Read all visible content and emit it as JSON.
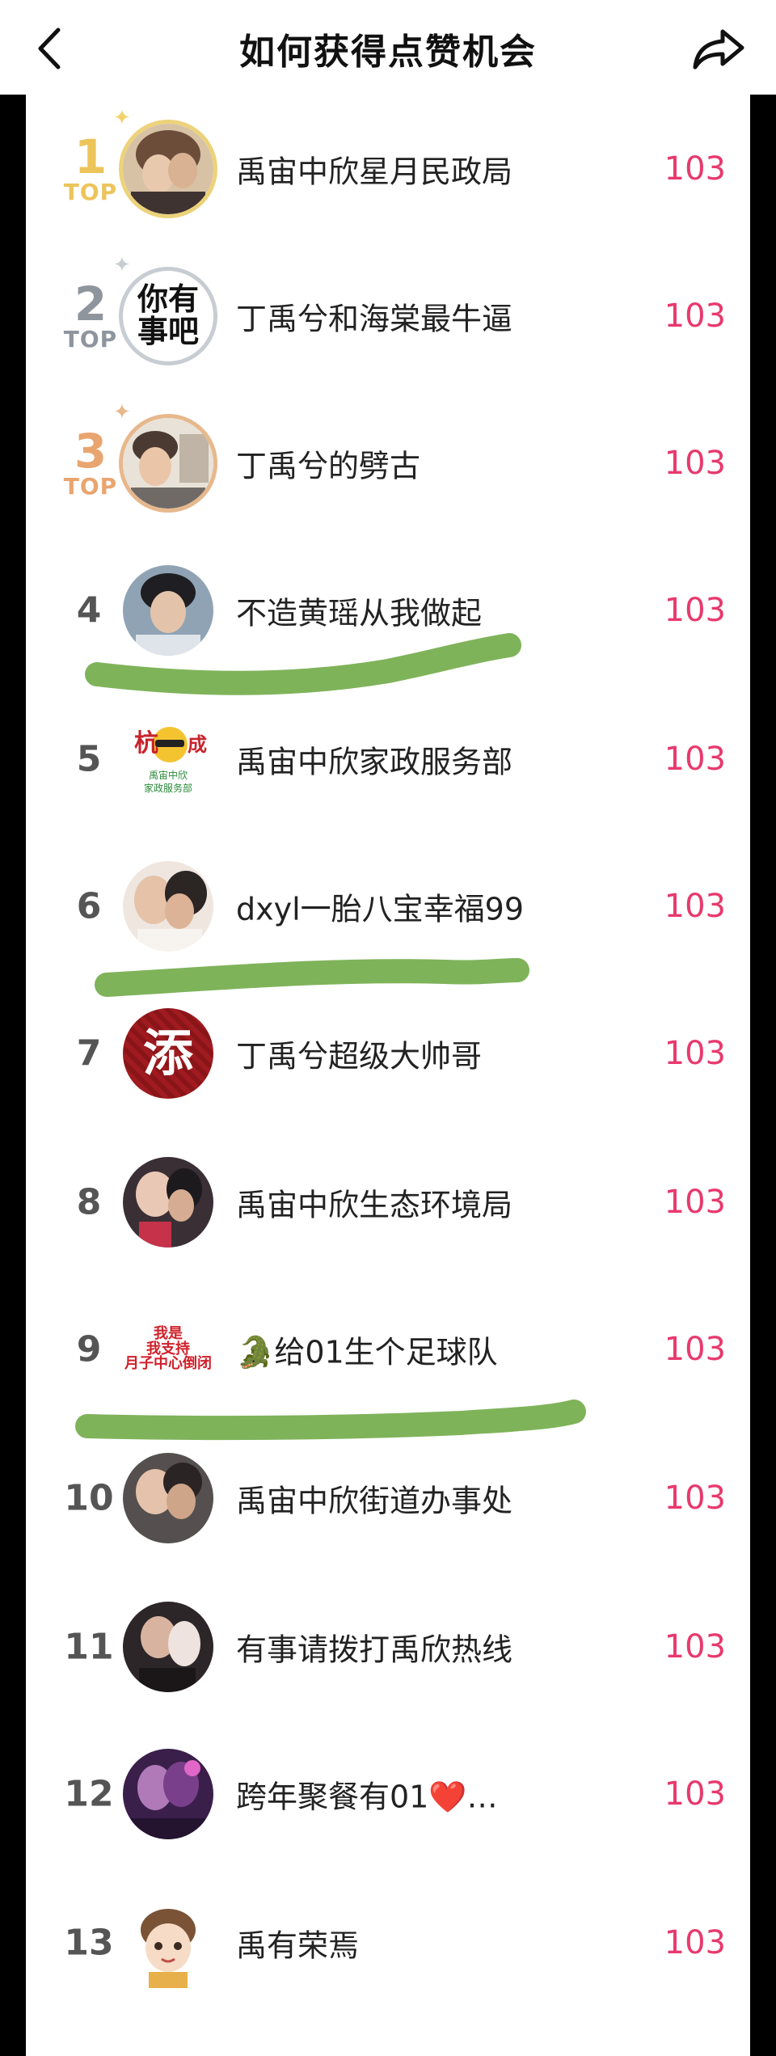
{
  "header": {
    "title": "如何获得点赞机会",
    "back_icon": "chevron-left-icon",
    "share_icon": "share-arrow-icon"
  },
  "colors": {
    "score": "#e8396d",
    "gold": "#ecc45a",
    "silver": "#8f959d",
    "bronze": "#e9a56f",
    "strike_green": "#7fb35a"
  },
  "rows": [
    {
      "rank": "1",
      "top_label": "TOP",
      "name": "禹宙中欣星月民政局",
      "score": "103"
    },
    {
      "rank": "2",
      "top_label": "TOP",
      "name": "丁禹兮和海棠最牛逼",
      "score": "103"
    },
    {
      "rank": "3",
      "top_label": "TOP",
      "name": "丁禹兮的劈古",
      "score": "103"
    },
    {
      "rank": "4",
      "name": "不造黄瑶从我做起",
      "score": "103"
    },
    {
      "rank": "5",
      "name": "禹宙中欣家政服务部",
      "score": "103"
    },
    {
      "rank": "6",
      "name": "dxyl一胎八宝幸福99",
      "score": "103"
    },
    {
      "rank": "7",
      "name": "丁禹兮超级大帅哥",
      "score": "103"
    },
    {
      "rank": "8",
      "name": "禹宙中欣生态环境局",
      "score": "103"
    },
    {
      "rank": "9",
      "name": "🐊给01生个足球队",
      "score": "103"
    },
    {
      "rank": "10",
      "name": "禹宙中欣街道办事处",
      "score": "103"
    },
    {
      "rank": "11",
      "name": "有事请拨打禹欣热线",
      "score": "103"
    },
    {
      "rank": "12",
      "name": "跨年聚餐有01❤️…",
      "score": "103"
    },
    {
      "rank": "13",
      "name": "禹有荣焉",
      "score": "103"
    }
  ],
  "avatars": {
    "row2_text": "你有\n事吧",
    "row5_text": "杭",
    "row5_subtext": "禹宙中欣\n家政服务部",
    "row7_text": "添",
    "row9_text": "我是\n我支持\n月子中心倒闭"
  }
}
